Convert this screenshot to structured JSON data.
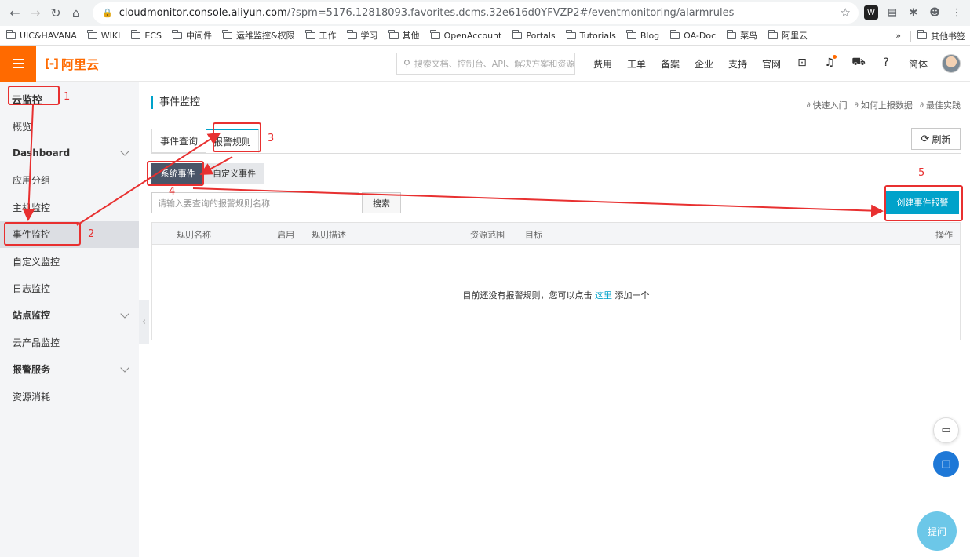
{
  "browser": {
    "url_host": "cloudmonitor.console.aliyun.com",
    "url_path": "/?spm=5176.12818093.favorites.dcms.32e616d0YFVZP2#/eventmonitoring/alarmrules",
    "bookmarks": [
      "UIC&HAVANA",
      "WIKI",
      "ECS",
      "中间件",
      "运维监控&权限",
      "工作",
      "学习",
      "其他",
      "OpenAccount",
      "Portals",
      "Tutorials",
      "Blog",
      "OA-Doc",
      "菜鸟",
      "阿里云"
    ],
    "bookmarks_more": "»",
    "bookmarks_other": "其他书签"
  },
  "topbar": {
    "logo_text": "阿里云",
    "search_placeholder": "搜索文档、控制台、API、解决方案和资源",
    "links": [
      "费用",
      "工单",
      "备案",
      "企业",
      "支持",
      "官网"
    ],
    "lang": "简体"
  },
  "sidebar": {
    "title": "云监控",
    "items": [
      {
        "label": "概览",
        "group": false
      },
      {
        "label": "Dashboard",
        "group": true
      },
      {
        "label": "应用分组",
        "group": false
      },
      {
        "label": "主机监控",
        "group": false
      },
      {
        "label": "事件监控",
        "group": false,
        "active": true
      },
      {
        "label": "自定义监控",
        "group": false
      },
      {
        "label": "日志监控",
        "group": false
      },
      {
        "label": "站点监控",
        "group": true
      },
      {
        "label": "云产品监控",
        "group": false
      },
      {
        "label": "报警服务",
        "group": true
      },
      {
        "label": "资源消耗",
        "group": false
      }
    ]
  },
  "main": {
    "title": "事件监控",
    "quick_links": [
      "快速入门",
      "如何上报数据",
      "最佳实践"
    ],
    "tabs": [
      "事件查询",
      "报警规则"
    ],
    "refresh_label": "刷新",
    "sub_tabs": [
      "系统事件",
      "自定义事件"
    ],
    "filter_placeholder": "请输入要查询的报警规则名称",
    "search_label": "搜索",
    "create_label": "创建事件报警",
    "columns": [
      "规则名称",
      "启用",
      "规则描述",
      "资源范围",
      "目标",
      "操作"
    ],
    "empty_prefix": "目前还没有报警规则，您可以点击 ",
    "empty_link": "这里",
    "empty_suffix": " 添加一个"
  },
  "floating": {
    "ask_label": "提问"
  },
  "annotations": [
    "1",
    "2",
    "3",
    "4",
    "5"
  ],
  "colors": {
    "brand": "#ff6a00",
    "accent": "#00a2ca",
    "annotation": "#e83030"
  }
}
